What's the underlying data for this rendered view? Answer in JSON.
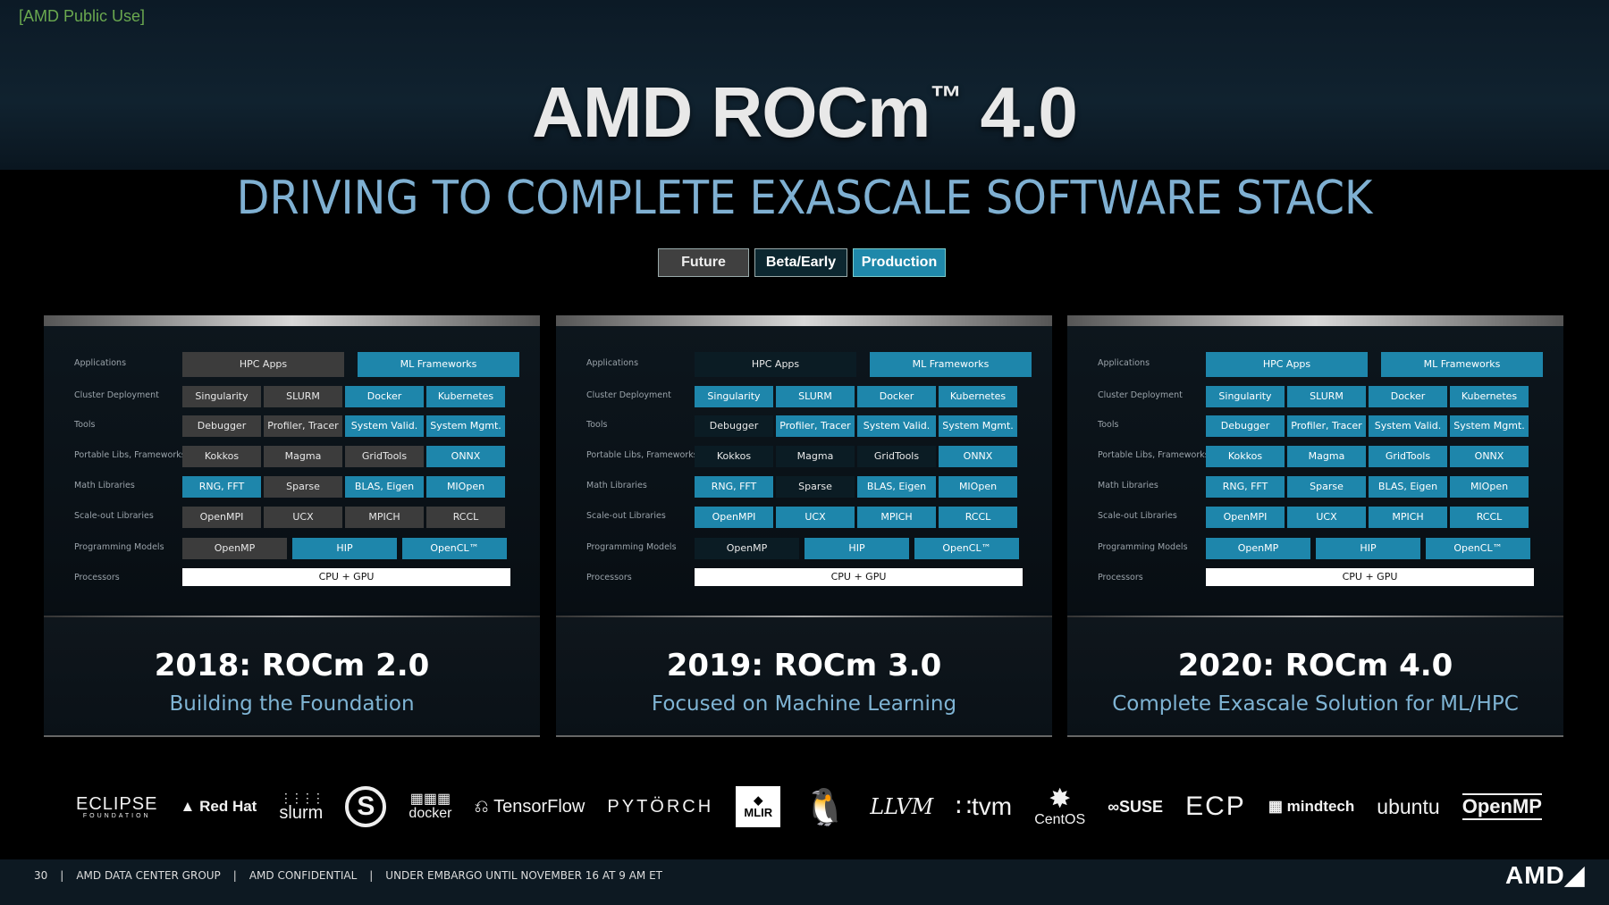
{
  "classification": "[AMD Public Use]",
  "title": {
    "main": "AMD ROCm",
    "tm": "™",
    "version": "4.0"
  },
  "subtitle": "DRIVING TO COMPLETE EXASCALE SOFTWARE STACK",
  "legend": [
    "Future",
    "Beta/Early",
    "Production"
  ],
  "row_labels": [
    "Applications",
    "Cluster Deployment",
    "Tools",
    "Portable Libs, Frameworks",
    "Math Libraries",
    "Scale-out Libraries",
    "Programming Models",
    "Processors"
  ],
  "panels": [
    {
      "heading": "2018: ROCm 2.0",
      "tagline": "Building the Foundation",
      "rows": [
        [
          {
            "t": "HPC Apps",
            "s": "future"
          },
          {
            "t": "ML Frameworks",
            "s": "production"
          }
        ],
        [
          {
            "t": "Singularity",
            "s": "future"
          },
          {
            "t": "SLURM",
            "s": "future"
          },
          {
            "t": "Docker",
            "s": "production"
          },
          {
            "t": "Kubernetes",
            "s": "production"
          }
        ],
        [
          {
            "t": "Debugger",
            "s": "future"
          },
          {
            "t": "Profiler, Tracer",
            "s": "future"
          },
          {
            "t": "System Valid.",
            "s": "production"
          },
          {
            "t": "System Mgmt.",
            "s": "production"
          }
        ],
        [
          {
            "t": "Kokkos",
            "s": "future"
          },
          {
            "t": "Magma",
            "s": "future"
          },
          {
            "t": "GridTools",
            "s": "future"
          },
          {
            "t": "ONNX",
            "s": "production"
          }
        ],
        [
          {
            "t": "RNG, FFT",
            "s": "production"
          },
          {
            "t": "Sparse",
            "s": "future"
          },
          {
            "t": "BLAS, Eigen",
            "s": "production"
          },
          {
            "t": "MIOpen",
            "s": "production"
          }
        ],
        [
          {
            "t": "OpenMPI",
            "s": "future"
          },
          {
            "t": "UCX",
            "s": "future"
          },
          {
            "t": "MPICH",
            "s": "future"
          },
          {
            "t": "RCCL",
            "s": "future"
          }
        ],
        [
          {
            "t": "OpenMP",
            "s": "future"
          },
          {
            "t": "HIP",
            "s": "production"
          },
          {
            "t": "OpenCL™",
            "s": "production"
          }
        ],
        [
          {
            "t": "CPU + GPU",
            "s": "white"
          }
        ]
      ]
    },
    {
      "heading": "2019: ROCm 3.0",
      "tagline": "Focused on Machine Learning",
      "rows": [
        [
          {
            "t": "HPC Apps",
            "s": "beta"
          },
          {
            "t": "ML Frameworks",
            "s": "production"
          }
        ],
        [
          {
            "t": "Singularity",
            "s": "production"
          },
          {
            "t": "SLURM",
            "s": "production"
          },
          {
            "t": "Docker",
            "s": "production"
          },
          {
            "t": "Kubernetes",
            "s": "production"
          }
        ],
        [
          {
            "t": "Debugger",
            "s": "beta"
          },
          {
            "t": "Profiler, Tracer",
            "s": "production"
          },
          {
            "t": "System Valid.",
            "s": "production"
          },
          {
            "t": "System Mgmt.",
            "s": "production"
          }
        ],
        [
          {
            "t": "Kokkos",
            "s": "beta"
          },
          {
            "t": "Magma",
            "s": "beta"
          },
          {
            "t": "GridTools",
            "s": "beta"
          },
          {
            "t": "ONNX",
            "s": "production"
          }
        ],
        [
          {
            "t": "RNG, FFT",
            "s": "production"
          },
          {
            "t": "Sparse",
            "s": "beta"
          },
          {
            "t": "BLAS, Eigen",
            "s": "production"
          },
          {
            "t": "MIOpen",
            "s": "production"
          }
        ],
        [
          {
            "t": "OpenMPI",
            "s": "production"
          },
          {
            "t": "UCX",
            "s": "production"
          },
          {
            "t": "MPICH",
            "s": "production"
          },
          {
            "t": "RCCL",
            "s": "production"
          }
        ],
        [
          {
            "t": "OpenMP",
            "s": "beta"
          },
          {
            "t": "HIP",
            "s": "production"
          },
          {
            "t": "OpenCL™",
            "s": "production"
          }
        ],
        [
          {
            "t": "CPU + GPU",
            "s": "white"
          }
        ]
      ]
    },
    {
      "heading": "2020: ROCm 4.0",
      "tagline": "Complete Exascale Solution for ML/HPC",
      "rows": [
        [
          {
            "t": "HPC Apps",
            "s": "production"
          },
          {
            "t": "ML Frameworks",
            "s": "production"
          }
        ],
        [
          {
            "t": "Singularity",
            "s": "production"
          },
          {
            "t": "SLURM",
            "s": "production"
          },
          {
            "t": "Docker",
            "s": "production"
          },
          {
            "t": "Kubernetes",
            "s": "production"
          }
        ],
        [
          {
            "t": "Debugger",
            "s": "production"
          },
          {
            "t": "Profiler, Tracer",
            "s": "production"
          },
          {
            "t": "System Valid.",
            "s": "production"
          },
          {
            "t": "System Mgmt.",
            "s": "production"
          }
        ],
        [
          {
            "t": "Kokkos",
            "s": "production"
          },
          {
            "t": "Magma",
            "s": "production"
          },
          {
            "t": "GridTools",
            "s": "production"
          },
          {
            "t": "ONNX",
            "s": "production"
          }
        ],
        [
          {
            "t": "RNG, FFT",
            "s": "production"
          },
          {
            "t": "Sparse",
            "s": "production"
          },
          {
            "t": "BLAS, Eigen",
            "s": "production"
          },
          {
            "t": "MIOpen",
            "s": "production"
          }
        ],
        [
          {
            "t": "OpenMPI",
            "s": "production"
          },
          {
            "t": "UCX",
            "s": "production"
          },
          {
            "t": "MPICH",
            "s": "production"
          },
          {
            "t": "RCCL",
            "s": "production"
          }
        ],
        [
          {
            "t": "OpenMP",
            "s": "production"
          },
          {
            "t": "HIP",
            "s": "production"
          },
          {
            "t": "OpenCL™",
            "s": "production"
          }
        ],
        [
          {
            "t": "CPU + GPU",
            "s": "white"
          }
        ]
      ]
    }
  ],
  "logos": {
    "eclipse": "ECLIPSE",
    "eclipse_sub": "FOUNDATION",
    "redhat": "Red Hat",
    "slurm": "slurm",
    "s_mark": "S",
    "docker": "docker",
    "tensorflow": "TensorFlow",
    "pytorch": "PYTÖRCH",
    "mlir": "MLIR",
    "llvm": "LLVM",
    "tvm": "tvm",
    "centos": "CentOS",
    "suse": "SUSE",
    "ecp": "ECP",
    "mindtech": "mindtech",
    "ubuntu": "ubuntu",
    "openmp": "OpenMP"
  },
  "footer": {
    "page": "30",
    "group": "AMD DATA CENTER GROUP",
    "confidential": "AMD CONFIDENTIAL",
    "embargo": "UNDER EMBARGO UNTIL NOVEMBER 16 AT 9 AM ET",
    "logo": "AMD"
  },
  "colors": {
    "production": "#1e86ab",
    "beta": "#0b1c24",
    "future": "#3c3c3c",
    "subtitle": "#7fb0d2"
  }
}
